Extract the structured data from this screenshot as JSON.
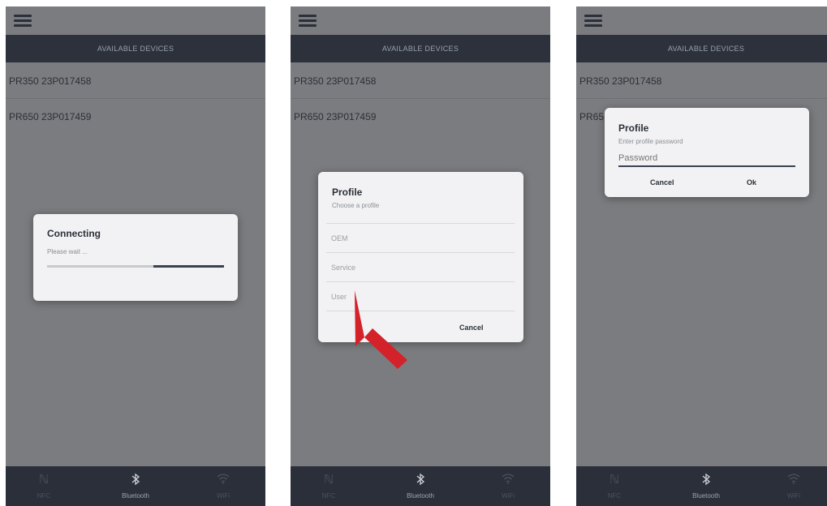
{
  "screens": [
    {
      "header": "AVAILABLE DEVICES",
      "devices": [
        "PR350 23P017458",
        "PR650 23P017459"
      ],
      "dialog": {
        "title": "Connecting",
        "subtitle": "Please wait ...",
        "progress": 0.4
      },
      "nav": [
        {
          "label": "NFC",
          "icon": "nfc-icon"
        },
        {
          "label": "Bluetooth",
          "icon": "bluetooth-icon",
          "active": true
        },
        {
          "label": "WiFi",
          "icon": "wifi-icon"
        }
      ]
    },
    {
      "header": "AVAILABLE DEVICES",
      "devices": [
        "PR350 23P017458",
        "PR650 23P017459"
      ],
      "dialog": {
        "title": "Profile",
        "subtitle": "Choose a profile",
        "options": [
          "OEM",
          "Service",
          "User"
        ],
        "cancel_label": "Cancel"
      },
      "annotation": {
        "icon": "red-arrow-pointer",
        "color": "#d3222a",
        "points_to": "User"
      },
      "nav": [
        {
          "label": "NFC",
          "icon": "nfc-icon"
        },
        {
          "label": "Bluetooth",
          "icon": "bluetooth-icon",
          "active": true
        },
        {
          "label": "WiFi",
          "icon": "wifi-icon"
        }
      ]
    },
    {
      "header": "AVAILABLE DEVICES",
      "devices": [
        "PR350 23P017458",
        "PR65"
      ],
      "dialog": {
        "title": "Profile",
        "subtitle": "Enter profile password",
        "placeholder": "Password",
        "cancel_label": "Cancel",
        "ok_label": "Ok"
      },
      "nav": [
        {
          "label": "NFC",
          "icon": "nfc-icon"
        },
        {
          "label": "Bluetooth",
          "icon": "bluetooth-icon",
          "active": true
        },
        {
          "label": "WiFi",
          "icon": "wifi-icon"
        }
      ]
    }
  ],
  "colors": {
    "background": "#7b7c7f",
    "header": "#2c313c",
    "dialog": "#f2f2f4",
    "progress_fill": "#3a4150",
    "accent_arrow": "#d3222a"
  }
}
